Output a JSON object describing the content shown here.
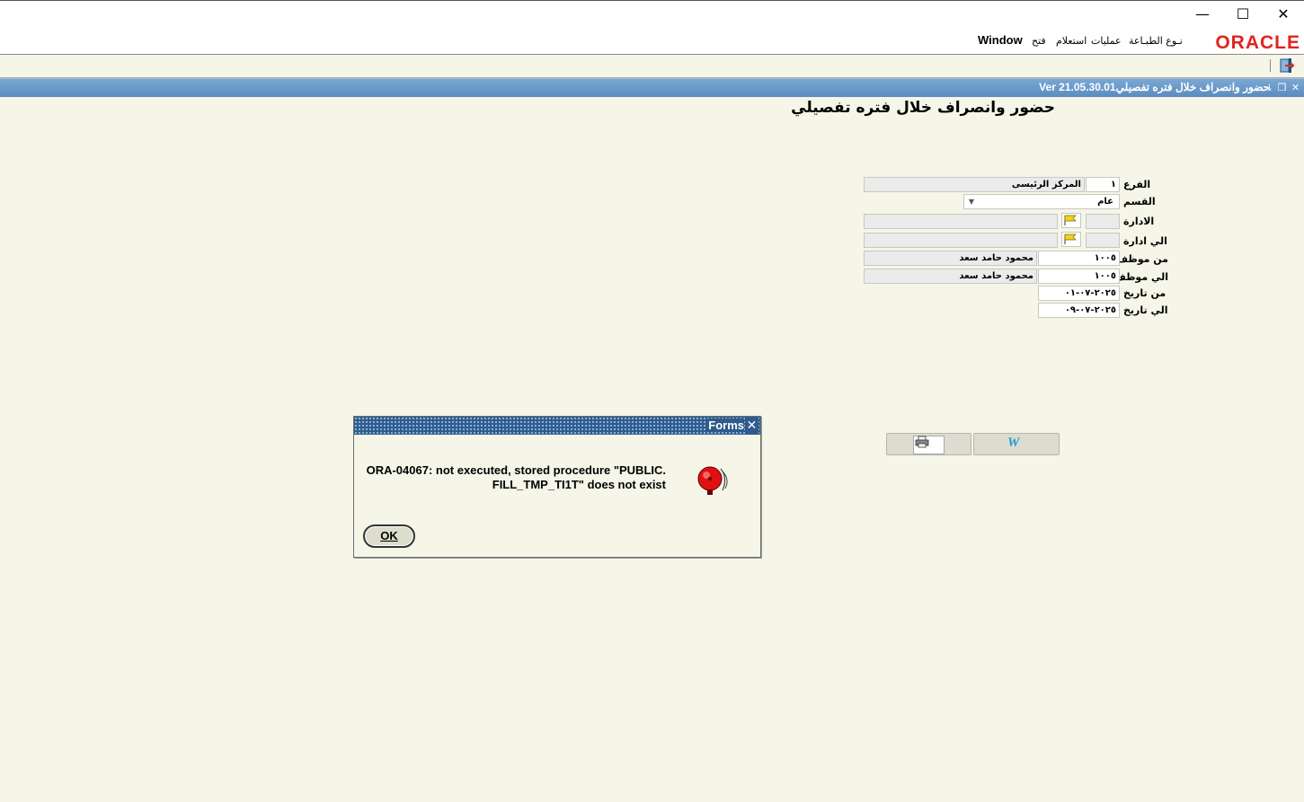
{
  "window": {
    "controls": {
      "minimize": "—",
      "maximize": "☐",
      "close": "✕"
    }
  },
  "menubar": {
    "logo": "ORACLE",
    "items": [
      "نـوع الطبـاعة",
      "عمليات",
      "استعلام",
      "فتح"
    ],
    "window_label": "Window"
  },
  "form": {
    "title_bar": "حضور وانصراف خلال فتره تفصيلي01.Ver 21.05.30",
    "heading": "حضور وانصراف خلال فتره تفصيلي",
    "fields": {
      "branch": {
        "label": "الفرع",
        "code": "١",
        "name": "المركز الرئيسى"
      },
      "section": {
        "label": "القسم",
        "value": "عام"
      },
      "department": {
        "label": "الادارة",
        "code": "",
        "name": ""
      },
      "to_department": {
        "label": "الي ادارة",
        "code": "",
        "name": ""
      },
      "from_employee": {
        "label": "من موظف",
        "code": "١٠٠٥",
        "name": "محمود حامد سعد"
      },
      "to_employee": {
        "label": "الي موظف",
        "code": "١٠٠٥",
        "name": "محمود حامد سعد"
      },
      "from_date": {
        "label": "من تاريخ",
        "value": "٢٠٢٥-٠٧-٠١"
      },
      "to_date": {
        "label": "الي تاريخ",
        "value": "٢٠٢٥-٠٧-٠٩"
      }
    },
    "buttons": {
      "print_icon": "printer-icon",
      "word_icon": "word-icon",
      "word_glyph": "W"
    }
  },
  "dialog": {
    "title": "Forms",
    "message_line1": "ORA-04067: not executed, stored procedure \"PUBLIC.",
    "message_line2": "FILL_TMP_TI1T\" does not exist",
    "ok_label": "OK",
    "icon": "alarm-bell-icon"
  },
  "colors": {
    "background": "#f5f5e8",
    "form_titlebar": "#5b8cc0",
    "oracle_red": "#e0241e",
    "dialog_titlebar": "#2f5b8c"
  }
}
